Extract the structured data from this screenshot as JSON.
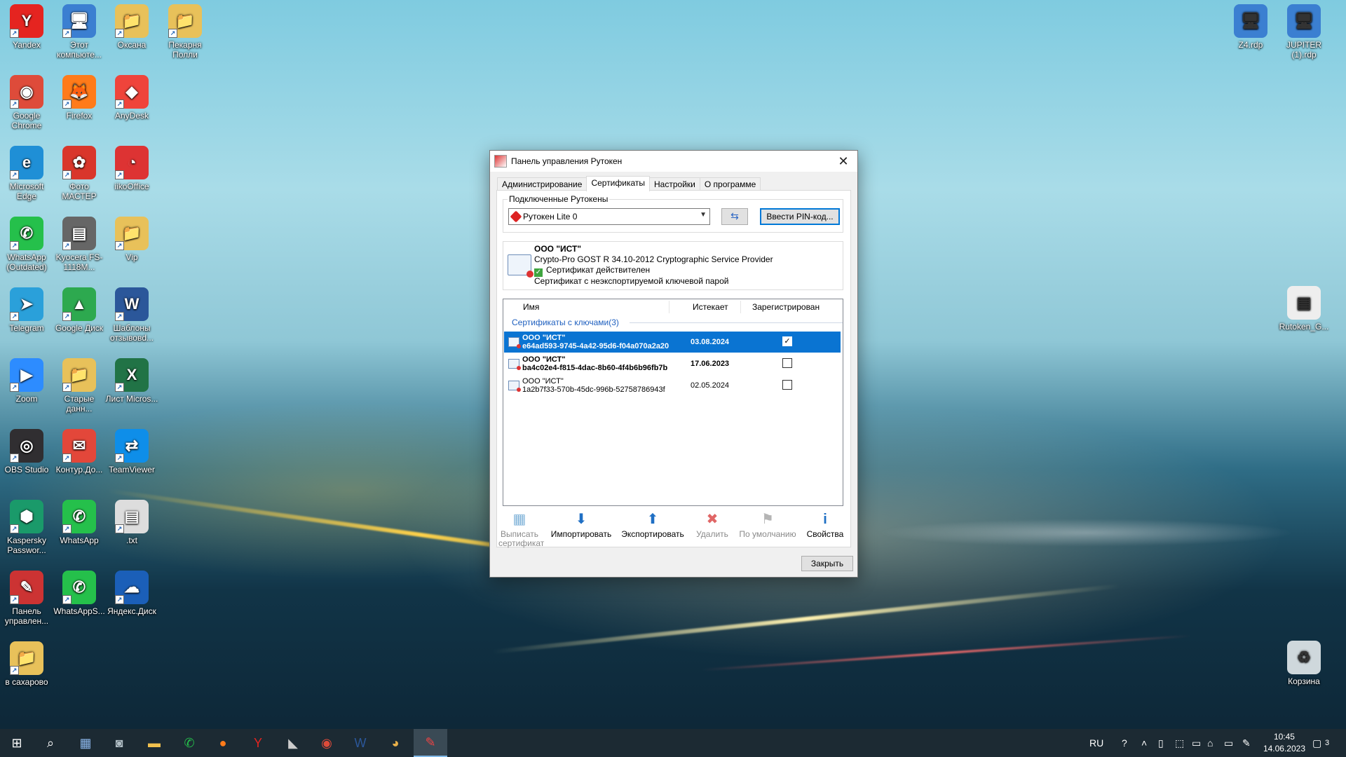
{
  "desktop": {
    "icons_left": [
      {
        "label": "Yandex",
        "glyph": "Y",
        "color": "#e52420"
      },
      {
        "label": "Этот компьюте...",
        "glyph": "🖥",
        "color": "#3b7fd1"
      },
      {
        "label": "Оксана",
        "glyph": "📁",
        "color": "#e8c15a"
      },
      {
        "label": "Пекарня Полли",
        "glyph": "📁",
        "color": "#e8c15a"
      },
      {
        "label": "Google Chrome",
        "glyph": "◉",
        "color": "#de4b3a"
      },
      {
        "label": "Firefox",
        "glyph": "🦊",
        "color": "#ff7b1a"
      },
      {
        "label": "AnyDesk",
        "glyph": "◆",
        "color": "#ef443b"
      },
      {
        "label": "Microsoft Edge",
        "glyph": "e",
        "color": "#1f8fd6"
      },
      {
        "label": "Фото МАСТЕР",
        "glyph": "✿",
        "color": "#d9362b"
      },
      {
        "label": "iikoOffice",
        "glyph": "◔",
        "color": "#d33"
      },
      {
        "label": "WhatsApp (Outdated)",
        "glyph": "✆",
        "color": "#25c04b"
      },
      {
        "label": "Kyocera FS-1118M...",
        "glyph": "▤",
        "color": "#666"
      },
      {
        "label": "Vip",
        "glyph": "📁",
        "color": "#e8c15a"
      },
      {
        "label": "Telegram",
        "glyph": "➤",
        "color": "#2aa0da"
      },
      {
        "label": "Google Диск",
        "glyph": "▲",
        "color": "#2da94f"
      },
      {
        "label": "Шаблоны отзывовd...",
        "glyph": "W",
        "color": "#2b579a"
      },
      {
        "label": "Zoom",
        "glyph": "▶",
        "color": "#2d8cff"
      },
      {
        "label": "Старые данн...",
        "glyph": "📁",
        "color": "#e8c15a"
      },
      {
        "label": "Лист Micros...",
        "glyph": "X",
        "color": "#217346"
      },
      {
        "label": "OBS Studio",
        "glyph": "◎",
        "color": "#302e31"
      },
      {
        "label": "Контур.До...",
        "glyph": "✉",
        "color": "#e3473a"
      },
      {
        "label": "TeamViewer",
        "glyph": "⇄",
        "color": "#0e8ee9"
      },
      {
        "label": "Kaspersky Passwor...",
        "glyph": "⬢",
        "color": "#1a9a6a"
      },
      {
        "label": "WhatsApp",
        "glyph": "✆",
        "color": "#25c04b"
      },
      {
        "label": ".txt",
        "glyph": "▤",
        "color": "#ddd"
      },
      {
        "label": "Панель управлен...",
        "glyph": "✎",
        "color": "#c33"
      },
      {
        "label": "WhatsAppS...",
        "glyph": "✆",
        "color": "#25c04b"
      },
      {
        "label": "Яндекс.Диск",
        "glyph": "☁",
        "color": "#1b5fb8"
      },
      {
        "label": "в сахарово",
        "glyph": "📁",
        "color": "#e8c15a"
      }
    ],
    "icons_right": [
      {
        "label": "Z4.rdp",
        "glyph": "🖥",
        "color": "#3b7fd1"
      },
      {
        "label": "JUPITER (1).rdp",
        "glyph": "🖥",
        "color": "#3b7fd1"
      },
      {
        "label": "Rutoken_G...",
        "glyph": "▤",
        "color": "#eee"
      },
      {
        "label": "Корзина",
        "glyph": "♻",
        "color": "#cfd8dc"
      }
    ]
  },
  "window": {
    "title": "Панель управления Рутокен",
    "close_glyph": "✕",
    "tabs": [
      "Администрирование",
      "Сертификаты",
      "Настройки",
      "О программе"
    ],
    "connected_label": "Подключенные Рутокены",
    "token_selected": "Рутокен Lite 0",
    "refresh_glyph": "⇆",
    "pin_button": "Ввести PIN-код...",
    "info": {
      "org": "ООО \"ИСТ\"",
      "provider": "Crypto-Pro GOST R 34.10-2012 Cryptographic Service Provider",
      "valid": "Сертификат действителен",
      "exportable": "Сертификат с неэкспортируемой ключевой парой"
    },
    "list": {
      "col_name": "Имя",
      "col_expires": "Истекает",
      "col_registered": "Зарегистрирован",
      "group": "Сертификаты с ключами(3)",
      "rows": [
        {
          "name": "ООО \"ИСТ\"",
          "id": "e64ad593-9745-4a42-95d6-f04a070a2a20",
          "expires": "03.08.2024",
          "registered": "✓"
        },
        {
          "name": "ООО \"ИСТ\"",
          "id": "ba4c02e4-f815-4dac-8b60-4f4b6b96fb7b",
          "expires": "17.06.2023",
          "registered": ""
        },
        {
          "name": "ООО \"ИСТ\"",
          "id": "1a2b7f33-570b-45dc-996b-52758786943f",
          "expires": "02.05.2024",
          "registered": ""
        }
      ]
    },
    "tools": {
      "issue": "Выписать сертификат",
      "import": "Импортировать",
      "export": "Экспортировать",
      "delete": "Удалить",
      "default": "По умолчанию",
      "props": "Свойства"
    },
    "close_button": "Закрыть"
  },
  "taskbar": {
    "start_glyph": "⊞",
    "search_glyph": "⌕",
    "lang": "RU",
    "time": "10:45",
    "date": "14.06.2023",
    "notifications": "3"
  }
}
